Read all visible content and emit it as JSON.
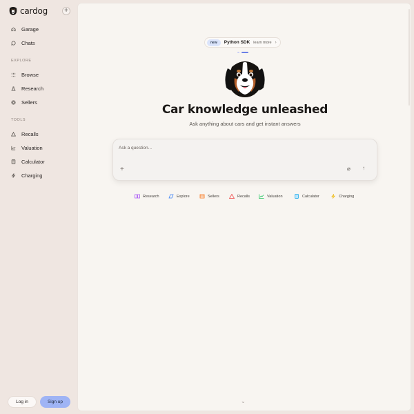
{
  "brand": {
    "name": "cardog"
  },
  "sidebar": {
    "new_label": "+",
    "primary": [
      {
        "label": "Garage",
        "icon": "garage-icon"
      },
      {
        "label": "Chats",
        "icon": "chat-bubble-icon"
      }
    ],
    "explore_label": "EXPLORE",
    "explore": [
      {
        "label": "Browse",
        "icon": "grid-dots-icon"
      },
      {
        "label": "Research",
        "icon": "flask-icon"
      },
      {
        "label": "Sellers",
        "icon": "at-sign-icon"
      }
    ],
    "tools_label": "TOOLS",
    "tools": [
      {
        "label": "Recalls",
        "icon": "warning-icon"
      },
      {
        "label": "Valuation",
        "icon": "chart-line-icon"
      },
      {
        "label": "Calculator",
        "icon": "calculator-icon"
      },
      {
        "label": "Charging",
        "icon": "lightning-icon"
      }
    ],
    "login_label": "Log in",
    "signup_label": "Sign up"
  },
  "banner": {
    "badge": "new",
    "title": "Python SDK",
    "link": "learn more",
    "chevron": "›"
  },
  "hero": {
    "title": "Car knowledge unleashed",
    "subtitle": "Ask anything about cars and get instant answers"
  },
  "composer": {
    "placeholder": "Ask a question...",
    "value": "",
    "add_glyph": "+",
    "attach_glyph": "⌀",
    "send_glyph": "↑"
  },
  "quick_actions": [
    {
      "label": "Research",
      "icon": "book-icon",
      "color": "#a855f7"
    },
    {
      "label": "Explore",
      "icon": "compass-icon",
      "color": "#3b82f6"
    },
    {
      "label": "Sellers",
      "icon": "store-icon",
      "color": "#f97316"
    },
    {
      "label": "Recalls",
      "icon": "warning-icon",
      "color": "#ef4444"
    },
    {
      "label": "Valuation",
      "icon": "chart-line-icon",
      "color": "#22c55e"
    },
    {
      "label": "Calculator",
      "icon": "calculator-icon",
      "color": "#0ea5e9"
    },
    {
      "label": "Charging",
      "icon": "lightning-icon",
      "color": "#eab308"
    }
  ],
  "footer": {
    "scroll_glyph": "⌄"
  }
}
